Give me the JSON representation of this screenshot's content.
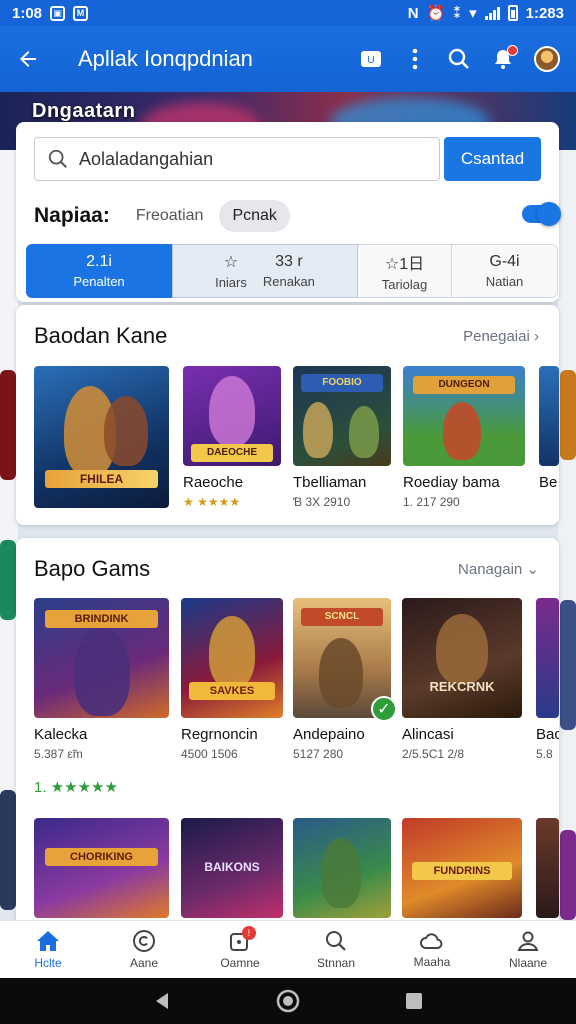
{
  "status_bar": {
    "time": "1:08",
    "right_time": "1:283"
  },
  "app_bar": {
    "title": "Apllak Ionqpdnian"
  },
  "hero": {
    "text": "Dngaatarn"
  },
  "search": {
    "placeholder": "Aolaladangahian",
    "button": "Csantad"
  },
  "filters": {
    "label": "Napiaa:",
    "option1": "Freoatian",
    "option2": "Pcnak"
  },
  "segments": [
    {
      "top": "2.1i",
      "bottom": "Penalten"
    },
    {
      "top": "☆",
      "bottom": "Iniars"
    },
    {
      "top": "33 r",
      "bottom": "Renakan"
    },
    {
      "top": "☆1日",
      "bottom": "Tariolag"
    },
    {
      "top": "G-4i",
      "bottom": "Natian"
    }
  ],
  "section1": {
    "title": "Baodan Kane",
    "link": "Penegaiai",
    "items": [
      {
        "name": "",
        "meta": "",
        "art_text": "FHILEA"
      },
      {
        "name": "Raeoche",
        "meta": "★ ★★★★",
        "art_text": "DAEOCHE"
      },
      {
        "name": "Tbelliaman",
        "meta": "Ɓ 3X 2910",
        "art_text": "FOOBIO"
      },
      {
        "name": "Roediay bama",
        "meta": "1. 217 290",
        "art_text": "DUNGEON"
      },
      {
        "name": "Be",
        "meta": "",
        "art_text": ""
      }
    ]
  },
  "section2": {
    "title": "Bapo Gams",
    "link": "Nanagain",
    "rating": "1. ★★★★★",
    "items": [
      {
        "name": "Kalecka",
        "meta": "5.387 ε̃m",
        "art_text": "BRINDINK"
      },
      {
        "name": "Regrnoncin",
        "meta": "4500 1506",
        "art_text": "SAVKES"
      },
      {
        "name": "Andepaino",
        "meta": "5127 280",
        "art_text": "SCNCL"
      },
      {
        "name": "Alincasi",
        "meta": "2/5.5C1 2/8",
        "art_text": "REKCRNK"
      },
      {
        "name": "Bac",
        "meta": "5.8",
        "art_text": ""
      }
    ],
    "row2": [
      {
        "art_text": "CHORIKING"
      },
      {
        "art_text": "BAIKONS"
      },
      {
        "art_text": ""
      },
      {
        "art_text": "FUNDRINS"
      },
      {
        "art_text": ""
      }
    ]
  },
  "bottom_nav": [
    {
      "label": "Hclte",
      "icon": "home-icon"
    },
    {
      "label": "Aane",
      "icon": "copyright-icon"
    },
    {
      "label": "Oamne",
      "icon": "notification-icon"
    },
    {
      "label": "Stnnan",
      "icon": "search-icon"
    },
    {
      "label": "Maaha",
      "icon": "cloud-icon"
    },
    {
      "label": "Nlaane",
      "icon": "profile-icon"
    }
  ],
  "colors": {
    "primary": "#1a6fe0",
    "accent_green": "#2e9d3a",
    "badge_red": "#e53935"
  }
}
